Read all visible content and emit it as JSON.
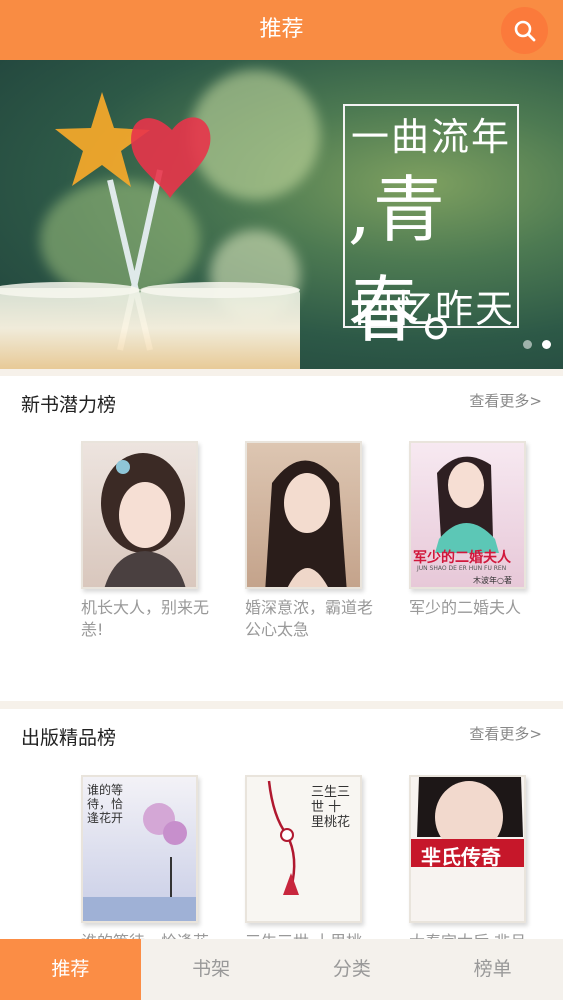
{
  "header": {
    "title": "推荐",
    "search_icon": "search-icon"
  },
  "banner": {
    "line1": "一曲流年",
    "line2": ",青春。",
    "line3": "回忆昨天",
    "page_count": 2,
    "active_page": 2
  },
  "sections": [
    {
      "title": "新书潜力榜",
      "more": "查看更多>",
      "books": [
        {
          "title": "机长大人，别来无恙!"
        },
        {
          "title": "婚深意浓，霸道老公心太急"
        },
        {
          "title": "军少的二婚夫人",
          "cover_text": "军少的二婚夫人",
          "cover_subtext": "JUN SHAO DE ER HUN FU REN",
          "cover_author": "木波年○著"
        }
      ]
    },
    {
      "title": "出版精品榜",
      "more": "查看更多>",
      "books": [
        {
          "title": "谁的等待，恰逢花开",
          "cover_text": "谁的等待，恰逢花开"
        },
        {
          "title": "三生三世 十里桃花",
          "cover_text": "三生三世 十里桃花"
        },
        {
          "title": "大秦宫太后·芈月",
          "cover_text": "芈氏传奇"
        }
      ]
    }
  ],
  "tabs": [
    {
      "label": "推荐",
      "active": true
    },
    {
      "label": "书架",
      "active": false
    },
    {
      "label": "分类",
      "active": false
    },
    {
      "label": "榜单",
      "active": false
    }
  ],
  "colors": {
    "accent": "#f98c43",
    "tab_active": "#fb8d45"
  }
}
